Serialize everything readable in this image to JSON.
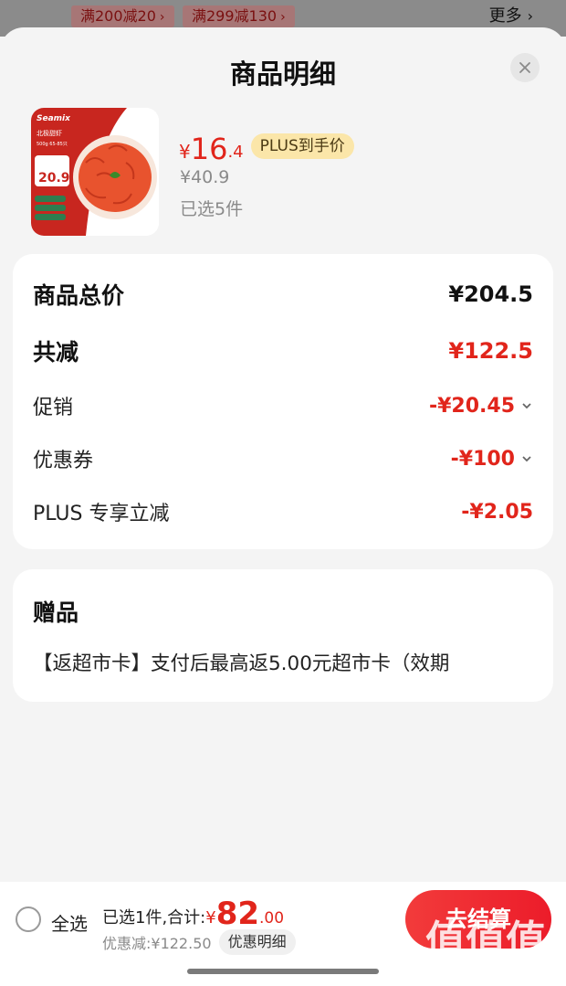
{
  "backdrop": {
    "coupons": [
      {
        "label": "满200减20"
      },
      {
        "label": "满299减130"
      }
    ],
    "more_label": "更多"
  },
  "sheet": {
    "title": "商品明细",
    "close_icon": "close-icon"
  },
  "product": {
    "image_brand": "Seamix",
    "image_name": "北极甜虾",
    "image_spec": "500g 65-85只",
    "image_price": "20.9",
    "price_symbol": "¥",
    "price_int": "16",
    "price_dec": ".4",
    "plus_badge": "PLUS到手价",
    "original_price": "¥40.9",
    "selected_count": "已选5件"
  },
  "totals": {
    "subtotal_label": "商品总价",
    "subtotal_value": "¥204.5",
    "reduction_label": "共减",
    "reduction_value": "¥122.5",
    "promo_label": "促销",
    "promo_value": "-¥20.45",
    "coupon_label": "优惠券",
    "coupon_value": "-¥100",
    "plus_label": "PLUS 专享立减",
    "plus_value": "-¥2.05"
  },
  "gift": {
    "title": "赠品",
    "text": "【返超市卡】支付后最高返5.00元超市卡（效期"
  },
  "bottom_bar": {
    "select_all_label": "全选",
    "summary_text": "已选1件,合计:",
    "total_symbol": "¥",
    "total_int": "82",
    "total_dec": ".00",
    "discount_text": "优惠减:¥122.50",
    "detail_button": "优惠明细",
    "checkout_button": "去结算"
  },
  "watermark": {
    "glyphs": "值值值",
    "url": "zhizhizhi.com"
  },
  "colors": {
    "accent_red": "#e1251b",
    "plus_gold": "#fbe6a9"
  }
}
